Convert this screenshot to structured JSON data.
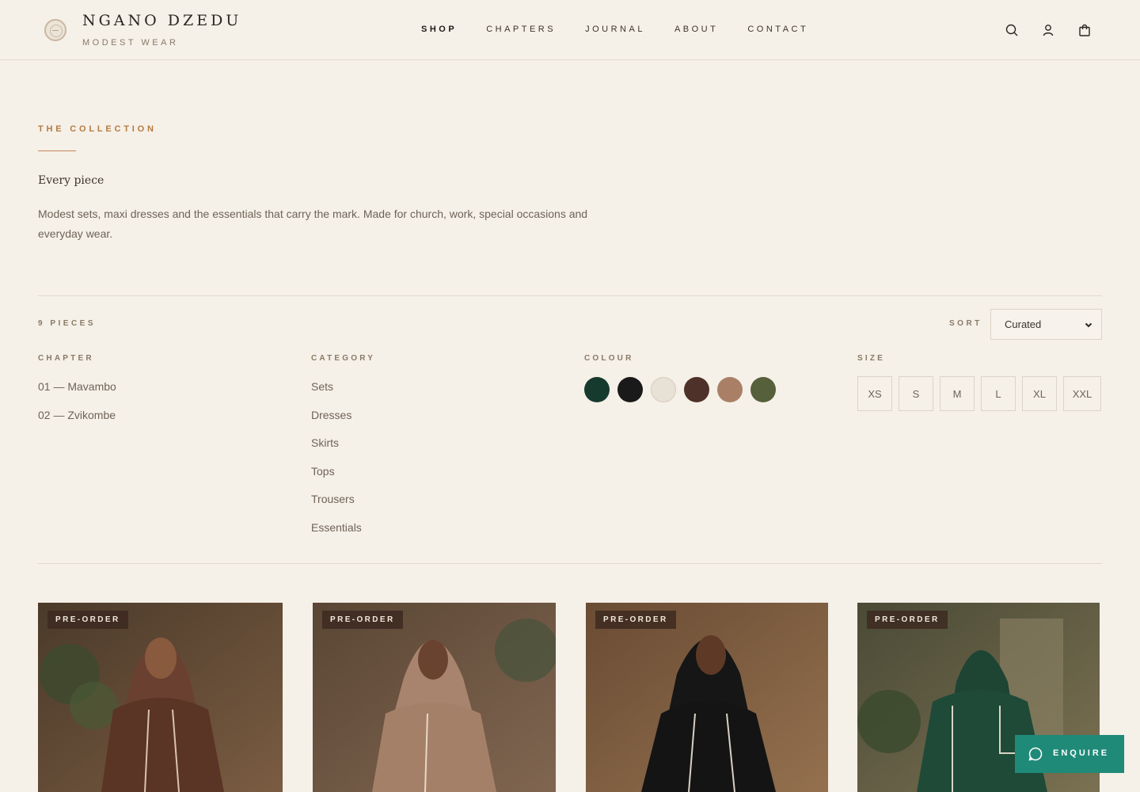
{
  "header": {
    "brand_name": "NGANO DZEDU",
    "brand_sub": "MODEST WEAR",
    "nav": [
      {
        "label": "SHOP",
        "active": true
      },
      {
        "label": "CHAPTERS",
        "active": false
      },
      {
        "label": "JOURNAL",
        "active": false
      },
      {
        "label": "ABOUT",
        "active": false
      },
      {
        "label": "CONTACT",
        "active": false
      }
    ],
    "icons": [
      "search-icon",
      "account-icon",
      "cart-icon"
    ]
  },
  "intro": {
    "eyebrow": "THE COLLECTION",
    "title": "Every piece",
    "text": "Modest sets, maxi dresses and the essentials that carry the mark. Made for church, work, special occasions and everyday wear."
  },
  "toolbar": {
    "count": "9 PIECES",
    "sort_label": "SORT",
    "sort_value": "Curated"
  },
  "filters": {
    "chapter": {
      "title": "CHAPTER",
      "items": [
        "01 — Mavambo",
        "02 — Zvikombe"
      ]
    },
    "category": {
      "title": "CATEGORY",
      "items": [
        "Sets",
        "Dresses",
        "Skirts",
        "Tops",
        "Trousers",
        "Essentials"
      ]
    },
    "colour": {
      "title": "COLOUR",
      "swatches": [
        "#173a2e",
        "#1a1a1a",
        "#e8e1d6",
        "#4e3128",
        "#a98066",
        "#56603a"
      ]
    },
    "size": {
      "title": "SIZE",
      "items": [
        "XS",
        "S",
        "M",
        "L",
        "XL",
        "XXL"
      ]
    }
  },
  "products": [
    {
      "badge": "PRE-ORDER",
      "garment_color": "#5a3425",
      "headscarf_color": "#6a4030"
    },
    {
      "badge": "PRE-ORDER",
      "garment_color": "#a58068",
      "headscarf_color": "#a8846e"
    },
    {
      "badge": "PRE-ORDER",
      "garment_color": "#141414",
      "headscarf_color": "#161616"
    },
    {
      "badge": "PRE-ORDER",
      "garment_color": "#1f4a38",
      "headscarf_color": "#1e4434"
    }
  ],
  "enquire": {
    "label": "ENQUIRE"
  },
  "colors": {
    "background": "#f5f0e8",
    "accent": "#b47b40",
    "enquire_green": "#1f8a78"
  }
}
